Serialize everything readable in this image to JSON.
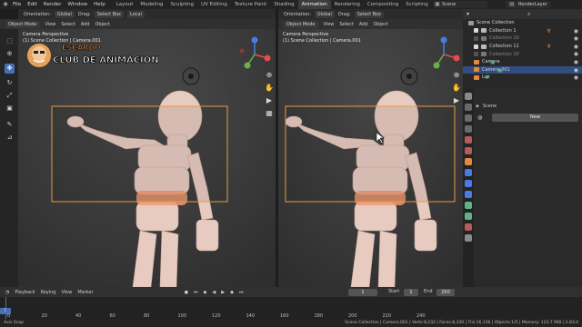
{
  "menubar": {
    "items": [
      "File",
      "Edit",
      "Render",
      "Window",
      "Help"
    ],
    "workspaces": [
      "Layout",
      "Modeling",
      "Sculpting",
      "UV Editing",
      "Texture Paint",
      "Shading",
      "Animation",
      "Rendering",
      "Compositing",
      "Scripting"
    ],
    "active_workspace": "Animation",
    "scene": "Scene",
    "view_layer": "RenderLayer"
  },
  "left_view": {
    "orientation_label": "Orientation:",
    "orientation_value": "Global",
    "drag_label": "Drag:",
    "drag_value": "Select Box",
    "pivot": "Local",
    "mode": "Object Mode",
    "menus": [
      "View",
      "Select",
      "Add",
      "Object"
    ],
    "overlay_line1": "Camera Perspective",
    "overlay_line2": "(1) Scene Collection | Camera.001"
  },
  "right_view": {
    "orientation_label": "Orientation:",
    "orientation_value": "Global",
    "drag_label": "Drag:",
    "drag_value": "Select Box",
    "mode": "Object Mode",
    "menus": [
      "View",
      "Select",
      "Add",
      "Object"
    ],
    "overlay_line1": "Camera Perspective",
    "overlay_line2": "(1) Scene Collection | Camera.001"
  },
  "logo": {
    "top": "ESCARDO",
    "bottom": "CLUB DE ANIMACION"
  },
  "outliner": {
    "header": "Scene Collection",
    "rows": [
      {
        "label": "Collection 1"
      },
      {
        "label": "Collection 10"
      },
      {
        "label": "Collection 11"
      },
      {
        "label": "Collection 10"
      },
      {
        "label": "Camera"
      },
      {
        "label": "Camera.001",
        "selected": true
      },
      {
        "label": "Luz"
      }
    ]
  },
  "properties": {
    "scene_label": "Scene",
    "new_button": "New"
  },
  "timeline": {
    "menus": [
      "Playback",
      "Keying",
      "View",
      "Marker"
    ],
    "current_frame": "1",
    "start_label": "Start",
    "start_value": "1",
    "end_label": "End",
    "end_value": "250",
    "ticks": [
      "0",
      "20",
      "40",
      "60",
      "80",
      "100",
      "120",
      "140",
      "160",
      "180",
      "200",
      "220",
      "240"
    ],
    "playhead_frame": "1"
  },
  "statusbar": {
    "left": "Axis Snap",
    "right": "Scene Collection | Camera.001 | Verts:8,232 | Faces:8,330 | Tris:16,136 | Objects:1/5 | Memory: 123.7 MiB | 2.83.0"
  },
  "colors": {
    "accent": "#4771b2",
    "camera_frame": "#e49a47",
    "selection": "#334d80"
  }
}
